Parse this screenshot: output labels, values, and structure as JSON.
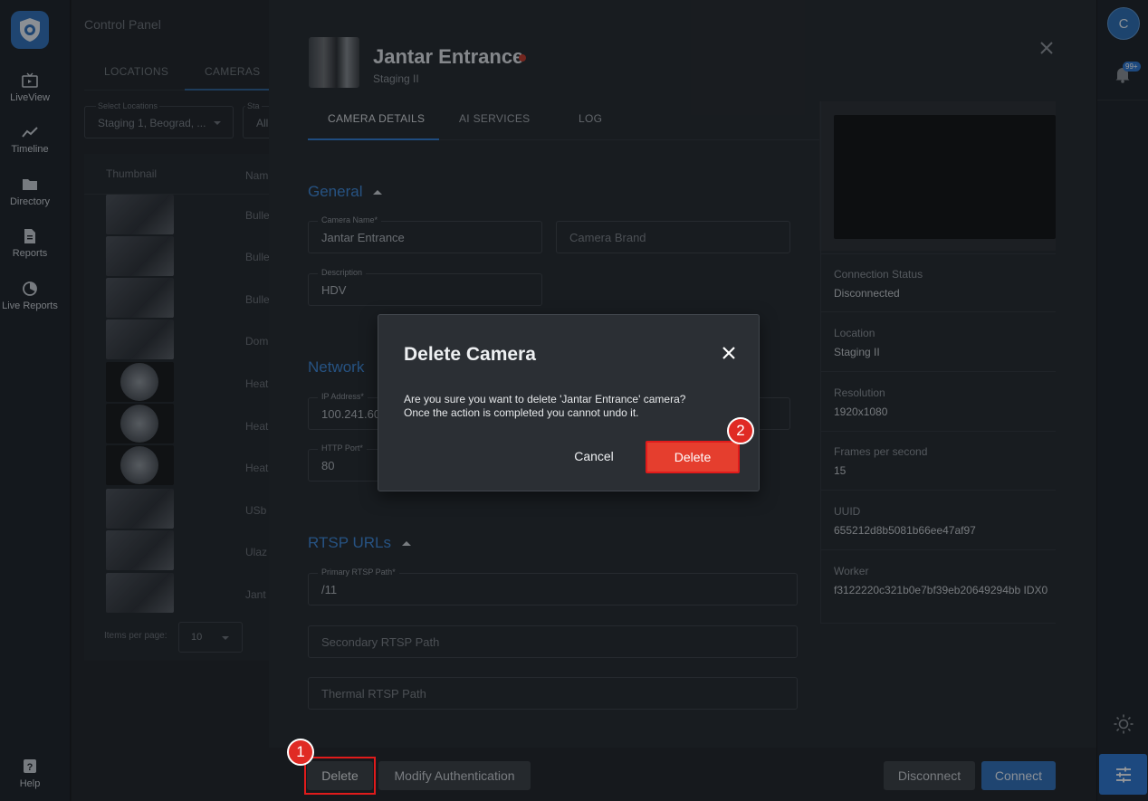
{
  "sidebar": {
    "items": [
      {
        "label": "LiveView",
        "icon": "tv-icon"
      },
      {
        "label": "Timeline",
        "icon": "trend-icon"
      },
      {
        "label": "Directory",
        "icon": "folder-icon"
      },
      {
        "label": "Reports",
        "icon": "document-icon"
      },
      {
        "label": "Live Reports",
        "icon": "pie-icon"
      }
    ],
    "help_label": "Help"
  },
  "background": {
    "title": "Control Panel",
    "tabs": [
      "LOCATIONS",
      "CAMERAS"
    ],
    "locations_label": "Select Locations",
    "locations_value": "Staging 1, Beograd, ...",
    "status_label": "Sta",
    "status_value": "All",
    "columns": [
      "Thumbnail",
      "Nam"
    ],
    "rows": [
      "Bulle",
      "Bulle",
      "Bulle",
      "Dom",
      "Heat",
      "Heat",
      "Heat",
      "USb",
      "Ulaz",
      "Jant"
    ],
    "items_per_page_label": "Items per page:",
    "items_per_page_value": "10"
  },
  "drawer": {
    "camera_name": "Jantar Entrance",
    "location": "Staging II",
    "status_color": "#c0392b",
    "tabs": [
      "CAMERA DETAILS",
      "AI SERVICES",
      "LOG"
    ],
    "general_title": "General",
    "camera_name_label": "Camera Name*",
    "camera_name_value": "Jantar Entrance",
    "camera_brand_placeholder": "Camera Brand",
    "description_label": "Description",
    "description_value": "HDV",
    "network_title": "Network",
    "ip_label": "IP Address*",
    "ip_value": "100.241.60",
    "http_port_label": "HTTP Port*",
    "http_port_value": "80",
    "rtsp_title": "RTSP URLs",
    "primary_rtsp_label": "Primary RTSP Path*",
    "primary_rtsp_value": "/11",
    "secondary_rtsp_placeholder": "Secondary RTSP Path",
    "thermal_rtsp_placeholder": "Thermal RTSP Path",
    "info": [
      {
        "key": "Connection Status",
        "value": "Disconnected"
      },
      {
        "key": "Location",
        "value": "Staging II"
      },
      {
        "key": "Resolution",
        "value": "1920x1080"
      },
      {
        "key": "Frames per second",
        "value": "15"
      },
      {
        "key": "UUID",
        "value": "655212d8b5081b66ee47af97"
      },
      {
        "key": "Worker",
        "value": "f3122220c321b0e7bf39eb20649294bb IDX0"
      }
    ],
    "buttons": {
      "delete": "Delete",
      "modify_auth": "Modify Authentication",
      "disconnect": "Disconnect",
      "connect": "Connect"
    }
  },
  "rightbar": {
    "avatar_letter": "C",
    "notification_badge": "99+"
  },
  "dialog": {
    "title": "Delete Camera",
    "message_line1": "Are you sure you want to delete 'Jantar Entrance' camera?",
    "message_line2": "Once the action is completed you cannot undo it.",
    "cancel": "Cancel",
    "delete": "Delete"
  },
  "markers": [
    "1",
    "2"
  ],
  "colors": {
    "accent_blue": "#2f7bd0",
    "danger_red": "#e53e2e"
  }
}
